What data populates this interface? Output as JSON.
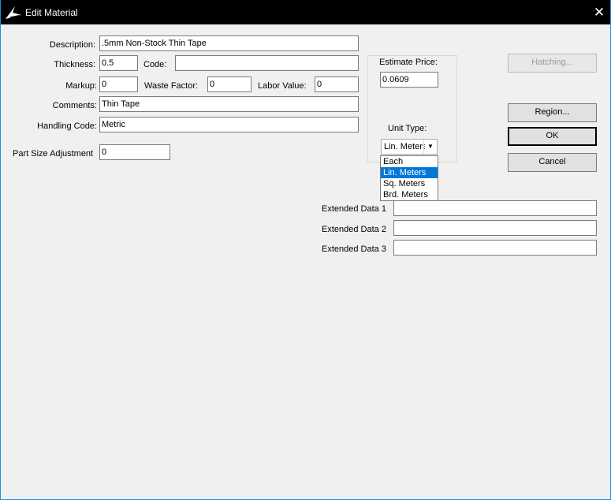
{
  "window": {
    "title": "Edit Material",
    "close_glyph": "✕"
  },
  "fields": {
    "description": {
      "label": "Description:",
      "value": ".5mm Non-Stock Thin Tape"
    },
    "thickness": {
      "label": "Thickness:",
      "value": "0.5"
    },
    "code": {
      "label": "Code:",
      "value": ""
    },
    "markup": {
      "label": "Markup:",
      "value": "0"
    },
    "waste_factor": {
      "label": "Waste Factor:",
      "value": "0"
    },
    "labor_value": {
      "label": "Labor Value:",
      "value": "0"
    },
    "comments": {
      "label": "Comments:",
      "value": "Thin Tape"
    },
    "handling_code": {
      "label": "Handling Code:",
      "value": "Metric"
    },
    "part_size_adjustment": {
      "label": "Part Size Adjustment",
      "value": "0"
    }
  },
  "estimate": {
    "label": "Estimate Price:",
    "value": "0.0609",
    "unit_type_label": "Unit Type:",
    "unit_type_value": "Lin. Meters",
    "options": [
      "Each",
      "Lin. Meters",
      "Sq. Meters",
      "Brd. Meters"
    ]
  },
  "buttons": {
    "hatching": "Hatching...",
    "region": "Region...",
    "ok": "OK",
    "cancel": "Cancel"
  },
  "extended": [
    {
      "label": "Extended Data 1",
      "value": ""
    },
    {
      "label": "Extended Data 2",
      "value": ""
    },
    {
      "label": "Extended Data 3",
      "value": ""
    }
  ]
}
